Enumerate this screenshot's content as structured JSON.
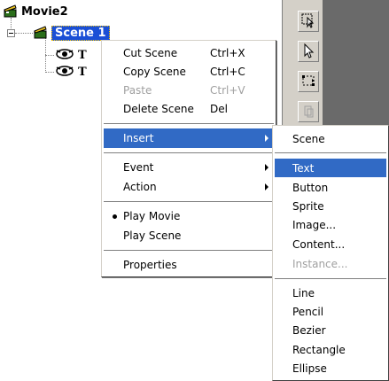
{
  "tree": {
    "root_label": "Movie2",
    "scene_label": "Scene 1",
    "child_labels": [
      "T",
      "T"
    ]
  },
  "context_menu": {
    "items": [
      {
        "label": "Cut Scene",
        "shortcut": "Ctrl+X",
        "disabled": false
      },
      {
        "label": "Copy Scene",
        "shortcut": "Ctrl+C",
        "disabled": false
      },
      {
        "label": "Paste",
        "shortcut": "Ctrl+V",
        "disabled": true
      },
      {
        "label": "Delete Scene",
        "shortcut": "Del",
        "disabled": false
      },
      {
        "label": "Insert",
        "submenu": true,
        "highlighted": true
      },
      {
        "label": "Event",
        "submenu": true
      },
      {
        "label": "Action",
        "submenu": true
      },
      {
        "label": "Play Movie",
        "checked": true
      },
      {
        "label": "Play Scene"
      },
      {
        "label": "Properties"
      }
    ]
  },
  "insert_submenu": {
    "items": [
      {
        "label": "Scene"
      },
      {
        "label": "Text",
        "highlighted": true
      },
      {
        "label": "Button"
      },
      {
        "label": "Sprite"
      },
      {
        "label": "Image..."
      },
      {
        "label": "Content..."
      },
      {
        "label": "Instance...",
        "disabled": true
      },
      {
        "label": "Line"
      },
      {
        "label": "Pencil"
      },
      {
        "label": "Bezier"
      },
      {
        "label": "Rectangle"
      },
      {
        "label": "Ellipse"
      }
    ]
  },
  "colors": {
    "highlight": "#316ac5",
    "selection": "#1a4fd6",
    "panel_gray": "#d4d0c8",
    "dark_area": "#6a6a6a"
  }
}
